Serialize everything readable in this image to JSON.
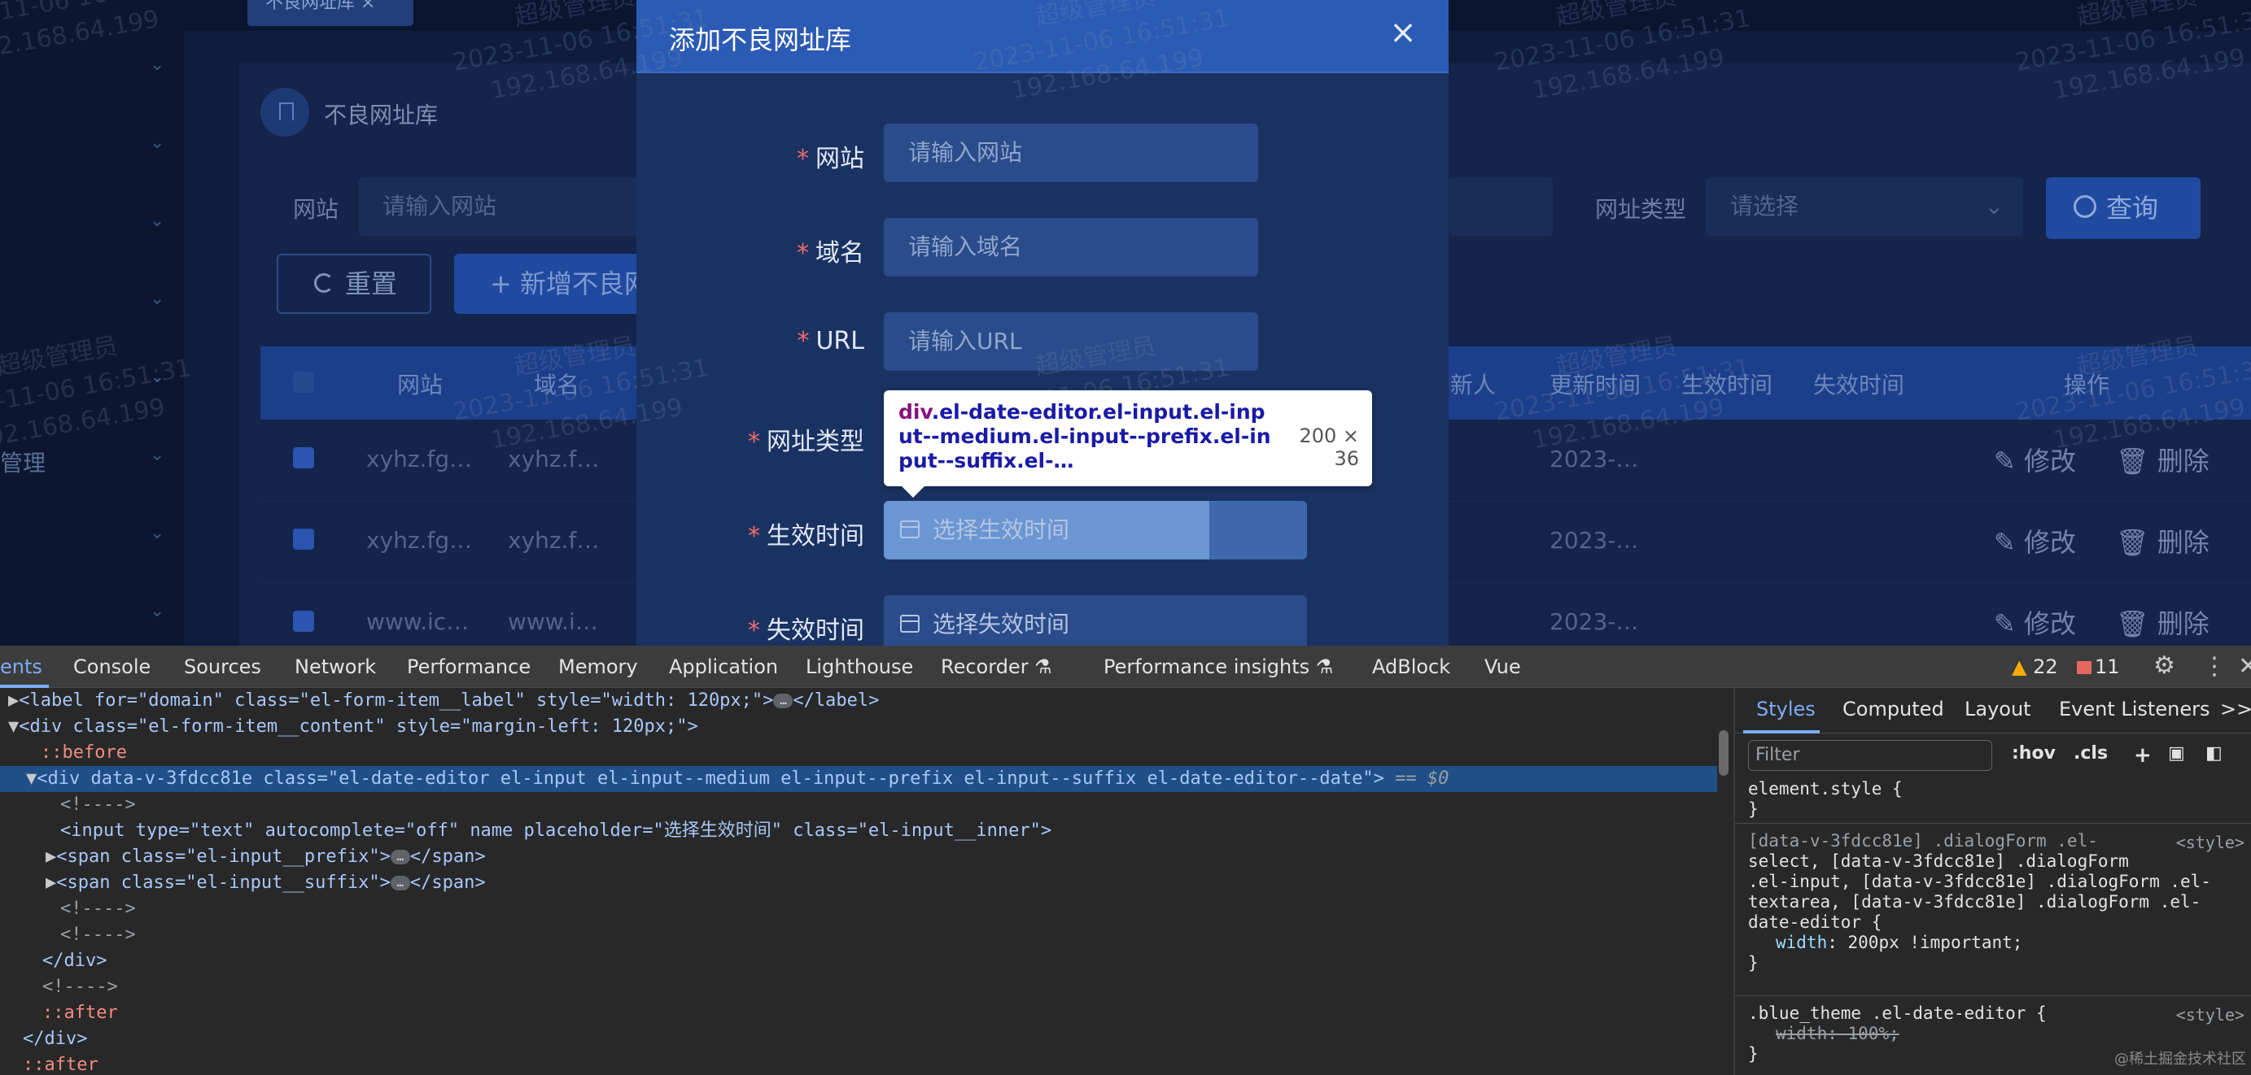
{
  "app": {
    "tag_label": "不良网址库",
    "tag_close": "×",
    "sidebar_text": "管理",
    "page_title": "不良网址库",
    "search": {
      "website_label": "网站",
      "website_placeholder": "请输入网站",
      "type_label": "网址类型",
      "type_placeholder": "请选择",
      "query_label": "查询",
      "reset_label": "重置",
      "add_label": "+ 新增不良网"
    },
    "table": {
      "headers": [
        "网站",
        "域名",
        "新人",
        "更新时间",
        "生效时间",
        "失效时间",
        "操作"
      ],
      "rows": [
        {
          "site": "xyhz.fg…",
          "domain": "xyhz.f…",
          "updated": "2023-…"
        },
        {
          "site": "xyhz.fg…",
          "domain": "xyhz.f…",
          "updated": "2023-…"
        },
        {
          "site": "www.ic…",
          "domain": "www.i…",
          "updated": "2023-…"
        }
      ],
      "edit_label": "修改",
      "delete_label": "删除"
    }
  },
  "watermark": {
    "line1": "超级管理员",
    "line2": "2023-11-06 16:51:31",
    "line3": "192.168.64.199"
  },
  "dialog": {
    "title": "添加不良网址库",
    "close": "×",
    "fields": [
      {
        "label": "网站",
        "placeholder": "请输入网站"
      },
      {
        "label": "域名",
        "placeholder": "请输入域名"
      },
      {
        "label": "URL",
        "placeholder": "请输入URL"
      },
      {
        "label": "网址类型",
        "placeholder": ""
      },
      {
        "label": "生效时间",
        "placeholder": "选择生效时间"
      },
      {
        "label": "失效时间",
        "placeholder": "选择失效时间"
      }
    ],
    "required_mark": "*"
  },
  "inspector_tooltip": {
    "tag": "div",
    "selector": ".el-date-editor.el-input.el-input--medium.el-input--prefix.el-input--suffix.el-…",
    "size": "200 × 36"
  },
  "devtools": {
    "tabs": [
      "ents",
      "Console",
      "Sources",
      "Network",
      "Performance",
      "Memory",
      "Application",
      "Lighthouse",
      "Recorder ⚗",
      "Performance insights ⚗",
      "AdBlock",
      "Vue"
    ],
    "warnings": "22",
    "errors": "11",
    "elements_lines": [
      "<label for=\"domain\" class=\"el-form-item__label\" style=\"width: 120px;\">",
      "<div class=\"el-form-item__content\" style=\"margin-left: 120px;\">",
      "::before",
      "<div data-v-3fdcc81e class=\"el-date-editor el-input el-input--medium el-input--prefix el-input--suffix el-date-editor--date\">",
      "<!---->",
      "<input type=\"text\" autocomplete=\"off\" name placeholder=\"选择生效时间\" class=\"el-input__inner\">",
      "<span class=\"el-input__prefix\">",
      "<span class=\"el-input__suffix\">",
      "<!---->",
      "<!---->",
      "</div>",
      "<!---->",
      "::after",
      "</div>",
      "::after"
    ],
    "styles": {
      "tabs": [
        "Styles",
        "Computed",
        "Layout",
        "Event Listeners",
        ">>"
      ],
      "filter_placeholder": "Filter",
      "hov": ":hov",
      "cls": ".cls",
      "rules": [
        {
          "selector": "element.style {",
          "body": "}"
        },
        {
          "selector_lines": [
            "[data-v-3fdcc81e] .dialogForm .el-",
            "select, [data-v-3fdcc81e] .dialogForm",
            ".el-input, [data-v-3fdcc81e] .dialogForm .el-",
            "textarea, [data-v-3fdcc81e] .dialogForm .el-",
            "date-editor {"
          ],
          "prop": "width",
          "value": "200px !important;",
          "source": "<style>"
        },
        {
          "selector": ".blue_theme .el-date-editor {",
          "prop": "width",
          "value": "100%;",
          "source": "<style>"
        }
      ]
    }
  },
  "corner_watermark": "@稀土掘金技术社区"
}
